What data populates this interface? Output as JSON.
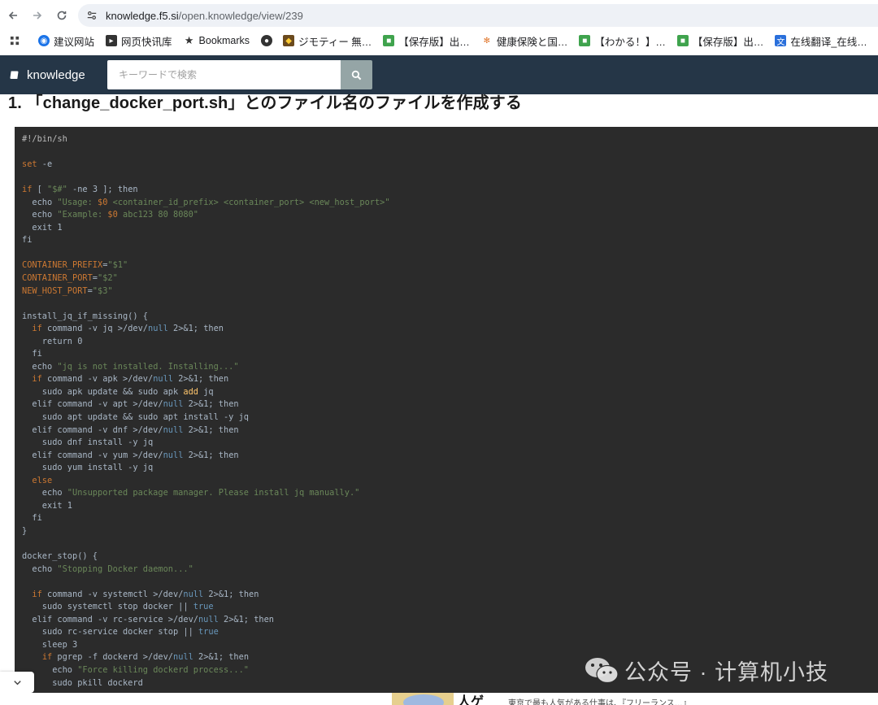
{
  "browser": {
    "url_host": "knowledge.f5.si",
    "url_path": "/open.knowledge/view/239",
    "bookmarks": [
      {
        "label": "建议网站",
        "icon": "blue-paw-icon",
        "color": "#1a73e8"
      },
      {
        "label": "网页快讯库",
        "icon": "flag-icon",
        "color": "#333333"
      },
      {
        "label": "Bookmarks",
        "icon": "star-icon",
        "color": "#333333"
      },
      {
        "label": "",
        "icon": "globe-icon",
        "color": "#333333"
      },
      {
        "label": "ジモティー 無…",
        "icon": "jimoty-icon",
        "color": "#6b4a1e"
      },
      {
        "label": "【保存版】出…",
        "icon": "green-square-icon",
        "color": "#3fa34d"
      },
      {
        "label": "健康保険と国…",
        "icon": "orange-logo-icon",
        "color": "#e0762c"
      },
      {
        "label": "【わかる！】…",
        "icon": "green-square-icon",
        "color": "#3fa34d"
      },
      {
        "label": "【保存版】出…",
        "icon": "green-square-icon",
        "color": "#3fa34d"
      },
      {
        "label": "在线翻译_在线…",
        "icon": "translate-icon",
        "color": "#2a6fdb"
      }
    ]
  },
  "site": {
    "brand": "knowledge",
    "search_placeholder": "キーワードで検索"
  },
  "article": {
    "heading": "1. 「change_docker_port.sh」とのファイル名のファイルを作成する"
  },
  "code_lines": [
    [
      [
        "cm",
        "#!/bin/sh"
      ]
    ],
    [],
    [
      [
        "k",
        "set"
      ],
      [
        "c",
        " -e"
      ]
    ],
    [],
    [
      [
        "k",
        "if"
      ],
      [
        "c",
        " [ "
      ],
      [
        "s",
        "\"$#\""
      ],
      [
        "c",
        " -ne 3 ]; then"
      ]
    ],
    [
      [
        "c",
        "  echo "
      ],
      [
        "s",
        "\"Usage: "
      ],
      [
        "k",
        "$0"
      ],
      [
        "s",
        " <container_id_prefix> <container_port> <new_host_port>\""
      ]
    ],
    [
      [
        "c",
        "  echo "
      ],
      [
        "s",
        "\"Example: "
      ],
      [
        "k",
        "$0"
      ],
      [
        "s",
        " abc123 80 8080\""
      ]
    ],
    [
      [
        "c",
        "  exit 1"
      ]
    ],
    [
      [
        "c",
        "fi"
      ]
    ],
    [],
    [
      [
        "k",
        "CONTAINER_PREFIX"
      ],
      [
        "c",
        "="
      ],
      [
        "s",
        "\"$1\""
      ]
    ],
    [
      [
        "k",
        "CONTAINER_PORT"
      ],
      [
        "c",
        "="
      ],
      [
        "s",
        "\"$2\""
      ]
    ],
    [
      [
        "k",
        "NEW_HOST_PORT"
      ],
      [
        "c",
        "="
      ],
      [
        "s",
        "\"$3\""
      ]
    ],
    [],
    [
      [
        "c",
        "install_jq_if_missing() {"
      ]
    ],
    [
      [
        "c",
        "  "
      ],
      [
        "k",
        "if"
      ],
      [
        "c",
        " command -v jq >/dev/"
      ],
      [
        "n",
        "null"
      ],
      [
        "c",
        " 2>&1; then"
      ]
    ],
    [
      [
        "c",
        "    return 0"
      ]
    ],
    [
      [
        "c",
        "  fi"
      ]
    ],
    [
      [
        "c",
        "  echo "
      ],
      [
        "s",
        "\"jq is not installed. Installing...\""
      ]
    ],
    [
      [
        "c",
        "  "
      ],
      [
        "k",
        "if"
      ],
      [
        "c",
        " command -v apk >/dev/"
      ],
      [
        "n",
        "null"
      ],
      [
        "c",
        " 2>&1; then"
      ]
    ],
    [
      [
        "c",
        "    sudo apk update && sudo apk "
      ],
      [
        "y",
        "add"
      ],
      [
        "c",
        " jq"
      ]
    ],
    [
      [
        "c",
        "  elif command -v apt >/dev/"
      ],
      [
        "n",
        "null"
      ],
      [
        "c",
        " 2>&1; then"
      ]
    ],
    [
      [
        "c",
        "    sudo apt update && sudo apt install -y jq"
      ]
    ],
    [
      [
        "c",
        "  elif command -v dnf >/dev/"
      ],
      [
        "n",
        "null"
      ],
      [
        "c",
        " 2>&1; then"
      ]
    ],
    [
      [
        "c",
        "    sudo dnf install -y jq"
      ]
    ],
    [
      [
        "c",
        "  elif command -v yum >/dev/"
      ],
      [
        "n",
        "null"
      ],
      [
        "c",
        " 2>&1; then"
      ]
    ],
    [
      [
        "c",
        "    sudo yum install -y jq"
      ]
    ],
    [
      [
        "c",
        "  "
      ],
      [
        "k",
        "else"
      ]
    ],
    [
      [
        "c",
        "    echo "
      ],
      [
        "s",
        "\"Unsupported package manager. Please install jq manually.\""
      ]
    ],
    [
      [
        "c",
        "    exit 1"
      ]
    ],
    [
      [
        "c",
        "  fi"
      ]
    ],
    [
      [
        "c",
        "}"
      ]
    ],
    [],
    [
      [
        "c",
        "docker_stop() {"
      ]
    ],
    [
      [
        "c",
        "  echo "
      ],
      [
        "s",
        "\"Stopping Docker daemon...\""
      ]
    ],
    [],
    [
      [
        "c",
        "  "
      ],
      [
        "k",
        "if"
      ],
      [
        "c",
        " command -v systemctl >/dev/"
      ],
      [
        "n",
        "null"
      ],
      [
        "c",
        " 2>&1; then"
      ]
    ],
    [
      [
        "c",
        "    sudo systemctl stop docker || "
      ],
      [
        "n",
        "true"
      ]
    ],
    [
      [
        "c",
        "  elif command -v rc-service >/dev/"
      ],
      [
        "n",
        "null"
      ],
      [
        "c",
        " 2>&1; then"
      ]
    ],
    [
      [
        "c",
        "    sudo rc-service docker stop || "
      ],
      [
        "n",
        "true"
      ]
    ],
    [
      [
        "c",
        "    sleep 3"
      ]
    ],
    [
      [
        "c",
        "    "
      ],
      [
        "k",
        "if"
      ],
      [
        "c",
        " pgrep -f dockerd >/dev/"
      ],
      [
        "n",
        "null"
      ],
      [
        "c",
        " 2>&1; then"
      ]
    ],
    [
      [
        "c",
        "      echo "
      ],
      [
        "s",
        "\"Force killing dockerd process...\""
      ]
    ],
    [
      [
        "c",
        "      sudo pkill dockerd"
      ]
    ]
  ],
  "watermark": "公众号 · 计算机小技",
  "ad": {
    "title": "人ゲ",
    "text": "東京で最も人気がある仕事は、『フリーランス…』"
  }
}
